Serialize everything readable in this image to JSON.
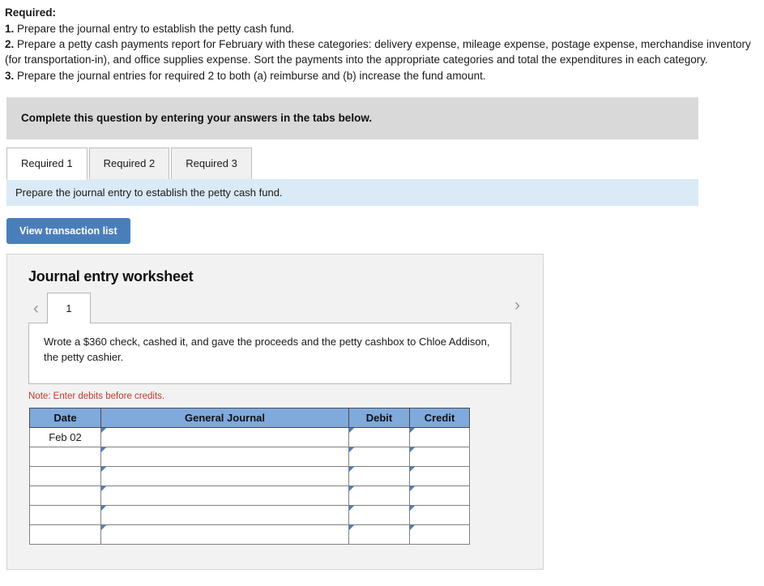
{
  "required": {
    "heading": "Required:",
    "items": [
      {
        "num": "1.",
        "text": " Prepare the journal entry to establish the petty cash fund."
      },
      {
        "num": "2.",
        "text": " Prepare a petty cash payments report for February with these categories: delivery expense, mileage expense, postage expense, merchandise inventory (for transportation-in), and office supplies expense. Sort the payments into the appropriate categories and total the expenditures in each category."
      },
      {
        "num": "3.",
        "text": " Prepare the journal entries for required 2 to both (a) reimburse and (b) increase the fund amount."
      }
    ]
  },
  "banner": {
    "text": "Complete this question by entering your answers in the tabs below."
  },
  "tabs": [
    {
      "label": "Required 1",
      "active": true
    },
    {
      "label": "Required 2",
      "active": false
    },
    {
      "label": "Required 3",
      "active": false
    }
  ],
  "tab_instruction": "Prepare the journal entry to establish the petty cash fund.",
  "toolbar": {
    "view_transaction_list_label": "View transaction list"
  },
  "worksheet": {
    "title": "Journal entry worksheet",
    "pager": {
      "prev_icon": "‹",
      "next_icon": "›",
      "pages": [
        "1"
      ],
      "active_page": "1"
    },
    "description": "Wrote a $360 check, cashed it, and gave the proceeds and the petty cashbox to Chloe Addison, the petty cashier.",
    "note": "Note: Enter debits before credits.",
    "table": {
      "columns": [
        "Date",
        "General Journal",
        "Debit",
        "Credit"
      ],
      "rows": [
        {
          "date": "Feb 02",
          "general_journal": "",
          "debit": "",
          "credit": ""
        },
        {
          "date": "",
          "general_journal": "",
          "debit": "",
          "credit": ""
        },
        {
          "date": "",
          "general_journal": "",
          "debit": "",
          "credit": ""
        },
        {
          "date": "",
          "general_journal": "",
          "debit": "",
          "credit": ""
        },
        {
          "date": "",
          "general_journal": "",
          "debit": "",
          "credit": ""
        },
        {
          "date": "",
          "general_journal": "",
          "debit": "",
          "credit": ""
        }
      ]
    }
  },
  "colors": {
    "button_blue": "#4a7ebb",
    "table_header_blue": "#80a9dc",
    "instruction_blue": "#daeaf6",
    "banner_gray": "#d9d9d9",
    "note_red": "#c0392b",
    "panel_gray": "#f2f2f2"
  }
}
